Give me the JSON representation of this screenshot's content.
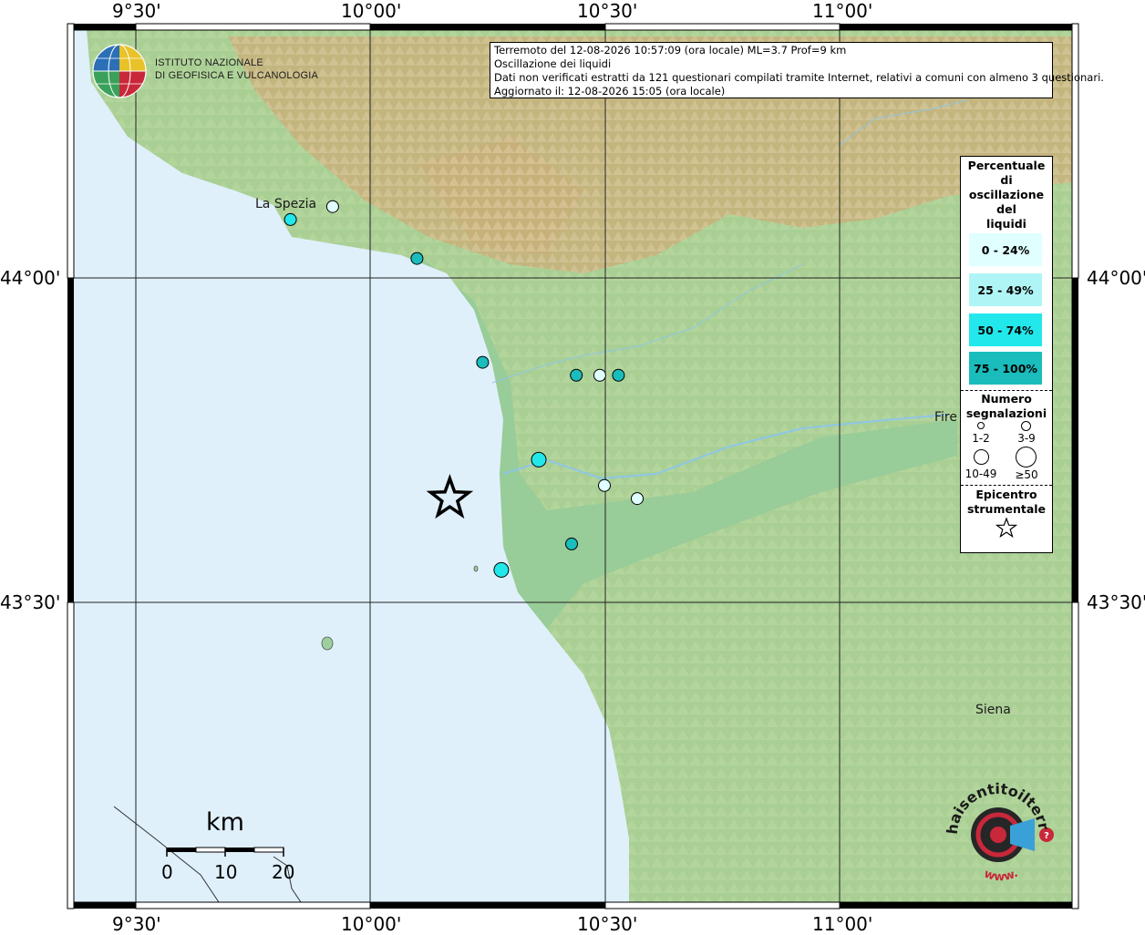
{
  "info": {
    "line1": "Terremoto del 12-08-2026 10:57:09 (ora locale) ML=3.7 Prof=9 km",
    "line2": "Oscillazione dei liquidi",
    "line3": "Dati non verificati estratti da 121 questionari compilati tramite Internet, relativi a comuni con almeno 3 questionari.",
    "line4": "Aggiornato il: 12-08-2026 15:05 (ora locale)"
  },
  "institute": {
    "line1": "ISTITUTO NAZIONALE",
    "line2": "DI GEOFISICA E VULCANOLOGIA"
  },
  "axes": {
    "lon_labels": [
      "9°30'",
      "10°00'",
      "10°30'",
      "11°00'"
    ],
    "lat_labels": [
      "44°00'",
      "43°30'"
    ]
  },
  "cities": {
    "la_spezia": "La Spezia",
    "firenze": "Fire",
    "siena": "Siena"
  },
  "legend": {
    "title": "Percentuale\ndi\noscillazione\ndel\nliquidi",
    "classes": [
      {
        "label": "0 - 24%",
        "color": "#e0ffff"
      },
      {
        "label": "25 - 49%",
        "color": "#b0f5f5"
      },
      {
        "label": "50 - 74%",
        "color": "#22e8ec"
      },
      {
        "label": "75 - 100%",
        "color": "#1abcbc"
      }
    ],
    "count_title": "Numero\nsegnalazioni",
    "count_classes": [
      "1-2",
      "3-9",
      "10-49",
      "≥50"
    ],
    "epicenter_title": "Epicentro\nstrumentale"
  },
  "scale": {
    "unit": "km",
    "ticks": [
      "0",
      "10",
      "20"
    ]
  },
  "brand": {
    "text": "haisentitoilterremoto.it",
    "url": "www."
  },
  "colors": {
    "sea": "#dff0fb",
    "plain": "#9ccf9c",
    "hills": "#b7d59e",
    "mountains": "#c9a472",
    "frame": "#000000"
  },
  "observations": [
    {
      "lon": 9.92,
      "lat": 44.11,
      "class": 0,
      "size": 1
    },
    {
      "lon": 9.83,
      "lat": 44.09,
      "class": 2,
      "size": 1
    },
    {
      "lon": 10.1,
      "lat": 44.03,
      "class": 3,
      "size": 1
    },
    {
      "lon": 10.24,
      "lat": 43.87,
      "class": 3,
      "size": 1
    },
    {
      "lon": 10.44,
      "lat": 43.85,
      "class": 3,
      "size": 1
    },
    {
      "lon": 10.49,
      "lat": 43.85,
      "class": 0,
      "size": 1
    },
    {
      "lon": 10.53,
      "lat": 43.85,
      "class": 3,
      "size": 1
    },
    {
      "lon": 10.36,
      "lat": 43.72,
      "class": 2,
      "size": 2
    },
    {
      "lon": 10.5,
      "lat": 43.68,
      "class": 0,
      "size": 1
    },
    {
      "lon": 10.57,
      "lat": 43.66,
      "class": 0,
      "size": 1
    },
    {
      "lon": 10.43,
      "lat": 43.59,
      "class": 3,
      "size": 1
    },
    {
      "lon": 10.28,
      "lat": 43.55,
      "class": 2,
      "size": 2
    }
  ],
  "epicenter": {
    "lon": 10.17,
    "lat": 43.66
  }
}
